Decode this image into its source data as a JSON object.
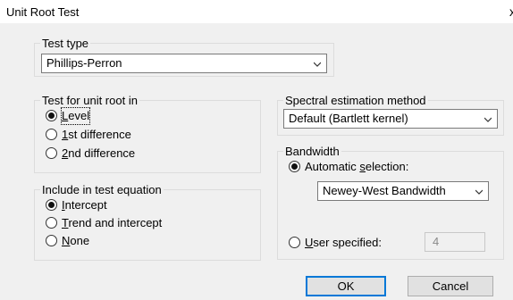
{
  "window": {
    "title": "Unit Root Test",
    "close_glyph": "x"
  },
  "test_type": {
    "legend": "Test type",
    "selected": "Phillips-Perron"
  },
  "unit_root_in": {
    "legend": "Test for unit root in",
    "options": [
      {
        "pre": "",
        "mnemonic": "L",
        "post": "evel",
        "selected": true
      },
      {
        "pre": "",
        "mnemonic": "1",
        "post": "st difference",
        "selected": false
      },
      {
        "pre": "",
        "mnemonic": "2",
        "post": "nd difference",
        "selected": false
      }
    ]
  },
  "include_in_equation": {
    "legend": "Include in test equation",
    "options": [
      {
        "pre": "",
        "mnemonic": "I",
        "post": "ntercept",
        "selected": true
      },
      {
        "pre": "",
        "mnemonic": "T",
        "post": "rend and intercept",
        "selected": false
      },
      {
        "pre": "",
        "mnemonic": "N",
        "post": "one",
        "selected": false
      }
    ]
  },
  "spectral": {
    "legend": "Spectral estimation method",
    "selected": "Default  (Bartlett kernel)"
  },
  "bandwidth": {
    "legend": "Bandwidth",
    "automatic": {
      "pre": "Automatic ",
      "mnemonic": "s",
      "post": "election:",
      "selected": true
    },
    "automatic_method": "Newey-West Bandwidth",
    "user": {
      "pre": "",
      "mnemonic": "U",
      "post": "ser specified:",
      "selected": false
    },
    "user_value": "4"
  },
  "buttons": {
    "ok": "OK",
    "cancel": "Cancel"
  },
  "colors": {
    "dialog_bg": "#f0f0f0",
    "default_button_border": "#0078d7"
  }
}
